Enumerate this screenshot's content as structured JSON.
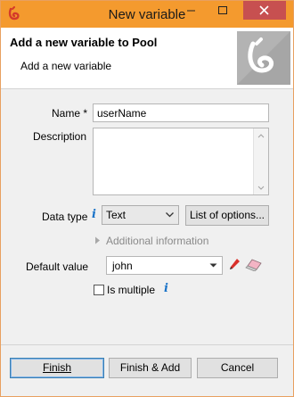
{
  "window": {
    "title": "New variable",
    "accent_color": "#f49a2e",
    "icons": {
      "app": "app-logo-icon",
      "minimize": "minimize-icon",
      "maximize": "maximize-icon",
      "close": "close-icon"
    }
  },
  "banner": {
    "title": "Add a new variable to Pool",
    "subtitle": "Add a new variable",
    "logo": "bonita-logo-icon"
  },
  "form": {
    "name_label": "Name *",
    "name_value": "userName",
    "description_label": "Description",
    "description_value": "",
    "data_type_label": "Data type",
    "data_type_value": "Text",
    "list_options_label": "List of options...",
    "additional_info_label": "Additional information",
    "default_value_label": "Default value",
    "default_value": "john",
    "is_multiple_label": "Is multiple",
    "is_multiple_checked": false
  },
  "footer": {
    "finish_label": "Finish",
    "finish_add_label": "Finish & Add",
    "cancel_label": "Cancel"
  }
}
